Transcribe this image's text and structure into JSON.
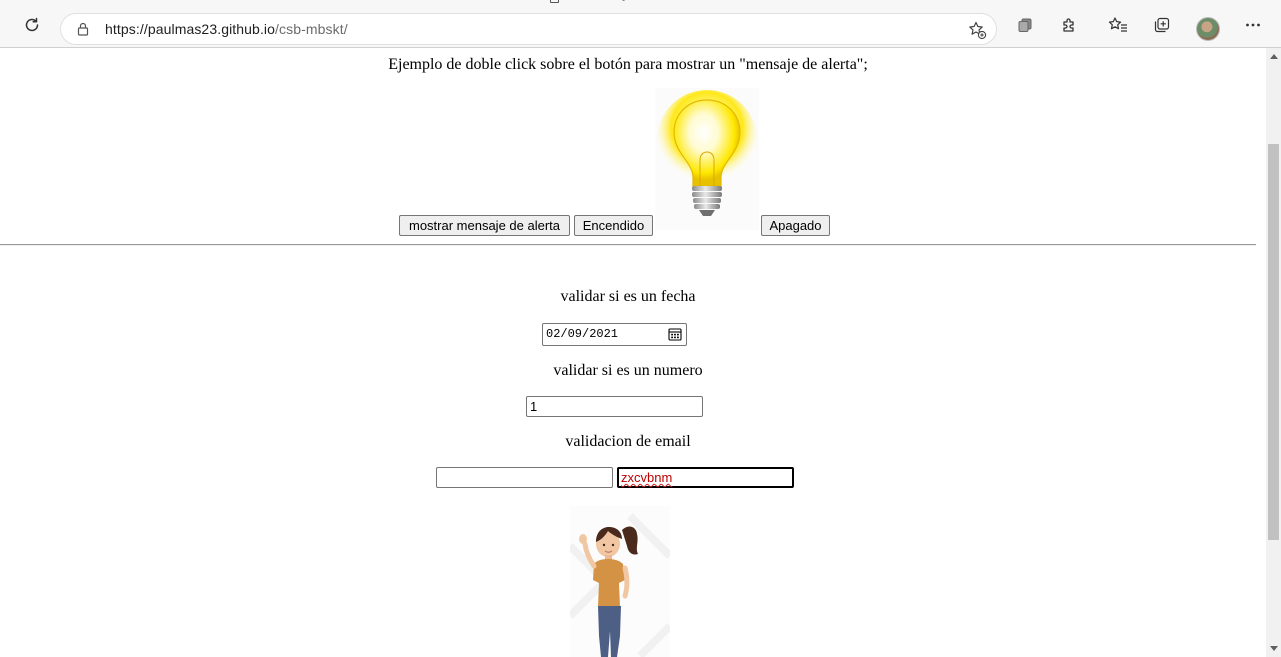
{
  "browser": {
    "url_host": "https://paulmas23.github.io",
    "url_path": "/csb-mbskt/",
    "toolbar_icons": [
      "reload-icon",
      "lock-icon",
      "add-favorite-icon",
      "collections-tab-icon",
      "extensions-icon",
      "favorites-icon",
      "collections-icon",
      "profile-avatar",
      "more-menu-icon"
    ]
  },
  "page": {
    "intro_text": "Ejemplo de doble click sobre el botón para mostrar un \"mensaje de alerta\";",
    "buttons": {
      "alert": "mostrar mensaje de alerta",
      "on": "Encendido",
      "off": "Apagado"
    },
    "labels": {
      "fecha": "validar si es un fecha",
      "numero": "validar si es un numero",
      "email": "validacion de email"
    },
    "fields": {
      "fecha_value": "02/09/2021",
      "numero_value": "1",
      "email_value_1": "",
      "email_value_2": "zxcvbnm"
    },
    "colors": {
      "invalid_text": "#c00000",
      "bulb_glow": "#ffe600"
    }
  }
}
